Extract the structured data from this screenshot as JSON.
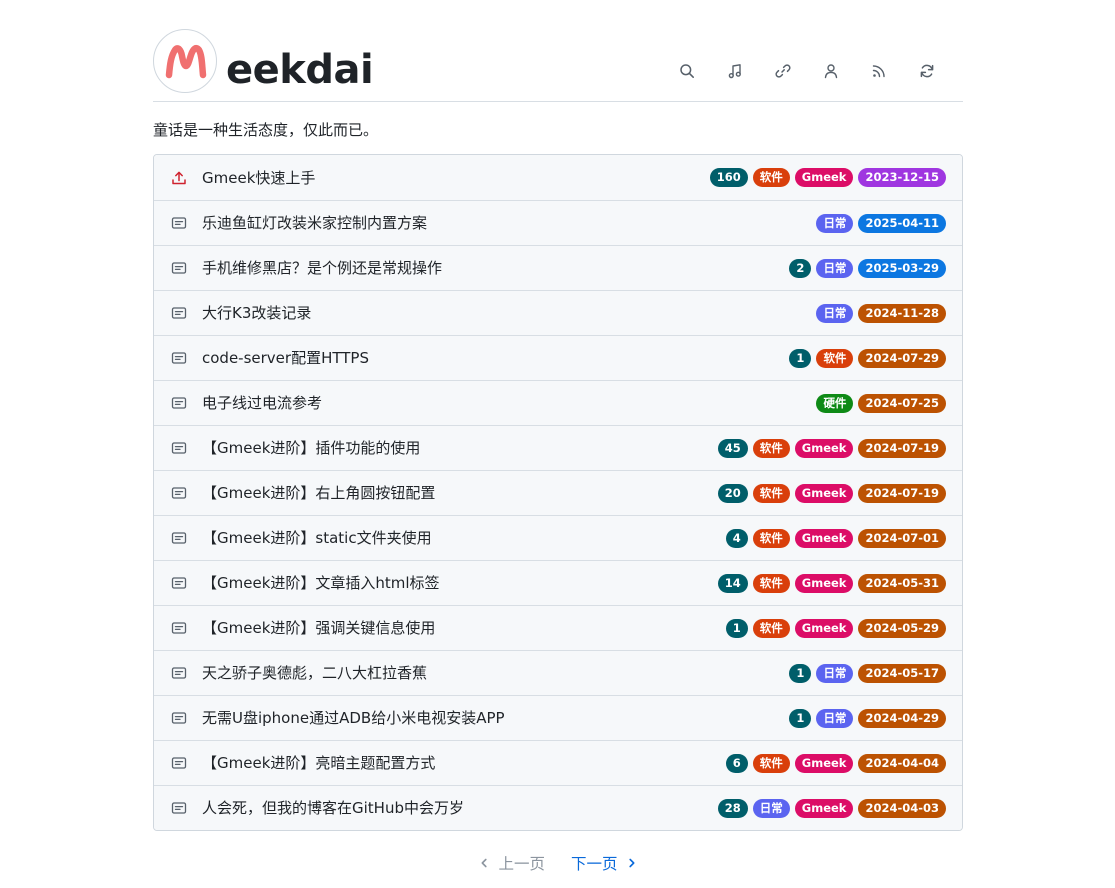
{
  "site": {
    "title": "eekdai",
    "avatar_letter": "M",
    "tagline": "童话是一种生活态度，仅此而已。",
    "accent": "#f07070"
  },
  "nav_icons": [
    "search-icon",
    "music-icon",
    "link-icon",
    "person-icon",
    "rss-icon",
    "sync-icon"
  ],
  "posts": [
    {
      "title": "Gmeek快速上手",
      "icon": "upload-icon",
      "labels": [
        {
          "text": "160",
          "cls": "cnt"
        },
        {
          "text": "软件",
          "cls": "soft"
        },
        {
          "text": "Gmeek",
          "cls": "gm"
        },
        {
          "text": "2023-12-15",
          "cls": "d-purple"
        }
      ]
    },
    {
      "title": "乐迪鱼缸灯改装米家控制内置方案",
      "icon": "note-icon",
      "labels": [
        {
          "text": "日常",
          "cls": "daily"
        },
        {
          "text": "2025-04-11",
          "cls": "d-blue"
        }
      ]
    },
    {
      "title": "手机维修黑店？是个例还是常规操作",
      "icon": "note-icon",
      "labels": [
        {
          "text": "2",
          "cls": "cnt"
        },
        {
          "text": "日常",
          "cls": "daily"
        },
        {
          "text": "2025-03-29",
          "cls": "d-blue"
        }
      ]
    },
    {
      "title": "大行K3改装记录",
      "icon": "note-icon",
      "labels": [
        {
          "text": "日常",
          "cls": "daily"
        },
        {
          "text": "2024-11-28",
          "cls": "d-orange"
        }
      ]
    },
    {
      "title": "code-server配置HTTPS",
      "icon": "note-icon",
      "labels": [
        {
          "text": "1",
          "cls": "cnt"
        },
        {
          "text": "软件",
          "cls": "soft"
        },
        {
          "text": "2024-07-29",
          "cls": "d-orange"
        }
      ]
    },
    {
      "title": "电子线过电流参考",
      "icon": "note-icon",
      "labels": [
        {
          "text": "硬件",
          "cls": "hw"
        },
        {
          "text": "2024-07-25",
          "cls": "d-orange"
        }
      ]
    },
    {
      "title": "【Gmeek进阶】插件功能的使用",
      "icon": "note-icon",
      "labels": [
        {
          "text": "45",
          "cls": "cnt"
        },
        {
          "text": "软件",
          "cls": "soft"
        },
        {
          "text": "Gmeek",
          "cls": "gm"
        },
        {
          "text": "2024-07-19",
          "cls": "d-orange"
        }
      ]
    },
    {
      "title": "【Gmeek进阶】右上角圆按钮配置",
      "icon": "note-icon",
      "labels": [
        {
          "text": "20",
          "cls": "cnt"
        },
        {
          "text": "软件",
          "cls": "soft"
        },
        {
          "text": "Gmeek",
          "cls": "gm"
        },
        {
          "text": "2024-07-19",
          "cls": "d-orange"
        }
      ]
    },
    {
      "title": "【Gmeek进阶】static文件夹使用",
      "icon": "note-icon",
      "labels": [
        {
          "text": "4",
          "cls": "cnt"
        },
        {
          "text": "软件",
          "cls": "soft"
        },
        {
          "text": "Gmeek",
          "cls": "gm"
        },
        {
          "text": "2024-07-01",
          "cls": "d-orange"
        }
      ]
    },
    {
      "title": "【Gmeek进阶】文章插入html标签",
      "icon": "note-icon",
      "labels": [
        {
          "text": "14",
          "cls": "cnt"
        },
        {
          "text": "软件",
          "cls": "soft"
        },
        {
          "text": "Gmeek",
          "cls": "gm"
        },
        {
          "text": "2024-05-31",
          "cls": "d-orange"
        }
      ]
    },
    {
      "title": "【Gmeek进阶】强调关键信息使用",
      "icon": "note-icon",
      "labels": [
        {
          "text": "1",
          "cls": "cnt"
        },
        {
          "text": "软件",
          "cls": "soft"
        },
        {
          "text": "Gmeek",
          "cls": "gm"
        },
        {
          "text": "2024-05-29",
          "cls": "d-orange"
        }
      ]
    },
    {
      "title": "天之骄子奥德彪，二八大杠拉香蕉",
      "icon": "note-icon",
      "labels": [
        {
          "text": "1",
          "cls": "cnt"
        },
        {
          "text": "日常",
          "cls": "daily"
        },
        {
          "text": "2024-05-17",
          "cls": "d-orange"
        }
      ]
    },
    {
      "title": "无需U盘iphone通过ADB给小米电视安装APP",
      "icon": "note-icon",
      "labels": [
        {
          "text": "1",
          "cls": "cnt"
        },
        {
          "text": "日常",
          "cls": "daily"
        },
        {
          "text": "2024-04-29",
          "cls": "d-orange"
        }
      ]
    },
    {
      "title": "【Gmeek进阶】亮暗主题配置方式",
      "icon": "note-icon",
      "labels": [
        {
          "text": "6",
          "cls": "cnt"
        },
        {
          "text": "软件",
          "cls": "soft"
        },
        {
          "text": "Gmeek",
          "cls": "gm"
        },
        {
          "text": "2024-04-04",
          "cls": "d-orange"
        }
      ]
    },
    {
      "title": "人会死，但我的博客在GitHub中会万岁",
      "icon": "note-icon",
      "labels": [
        {
          "text": "28",
          "cls": "cnt"
        },
        {
          "text": "日常",
          "cls": "daily"
        },
        {
          "text": "Gmeek",
          "cls": "gm"
        },
        {
          "text": "2024-04-03",
          "cls": "d-orange"
        }
      ]
    }
  ],
  "pagination": {
    "prev": "上一页",
    "next": "下一页"
  }
}
